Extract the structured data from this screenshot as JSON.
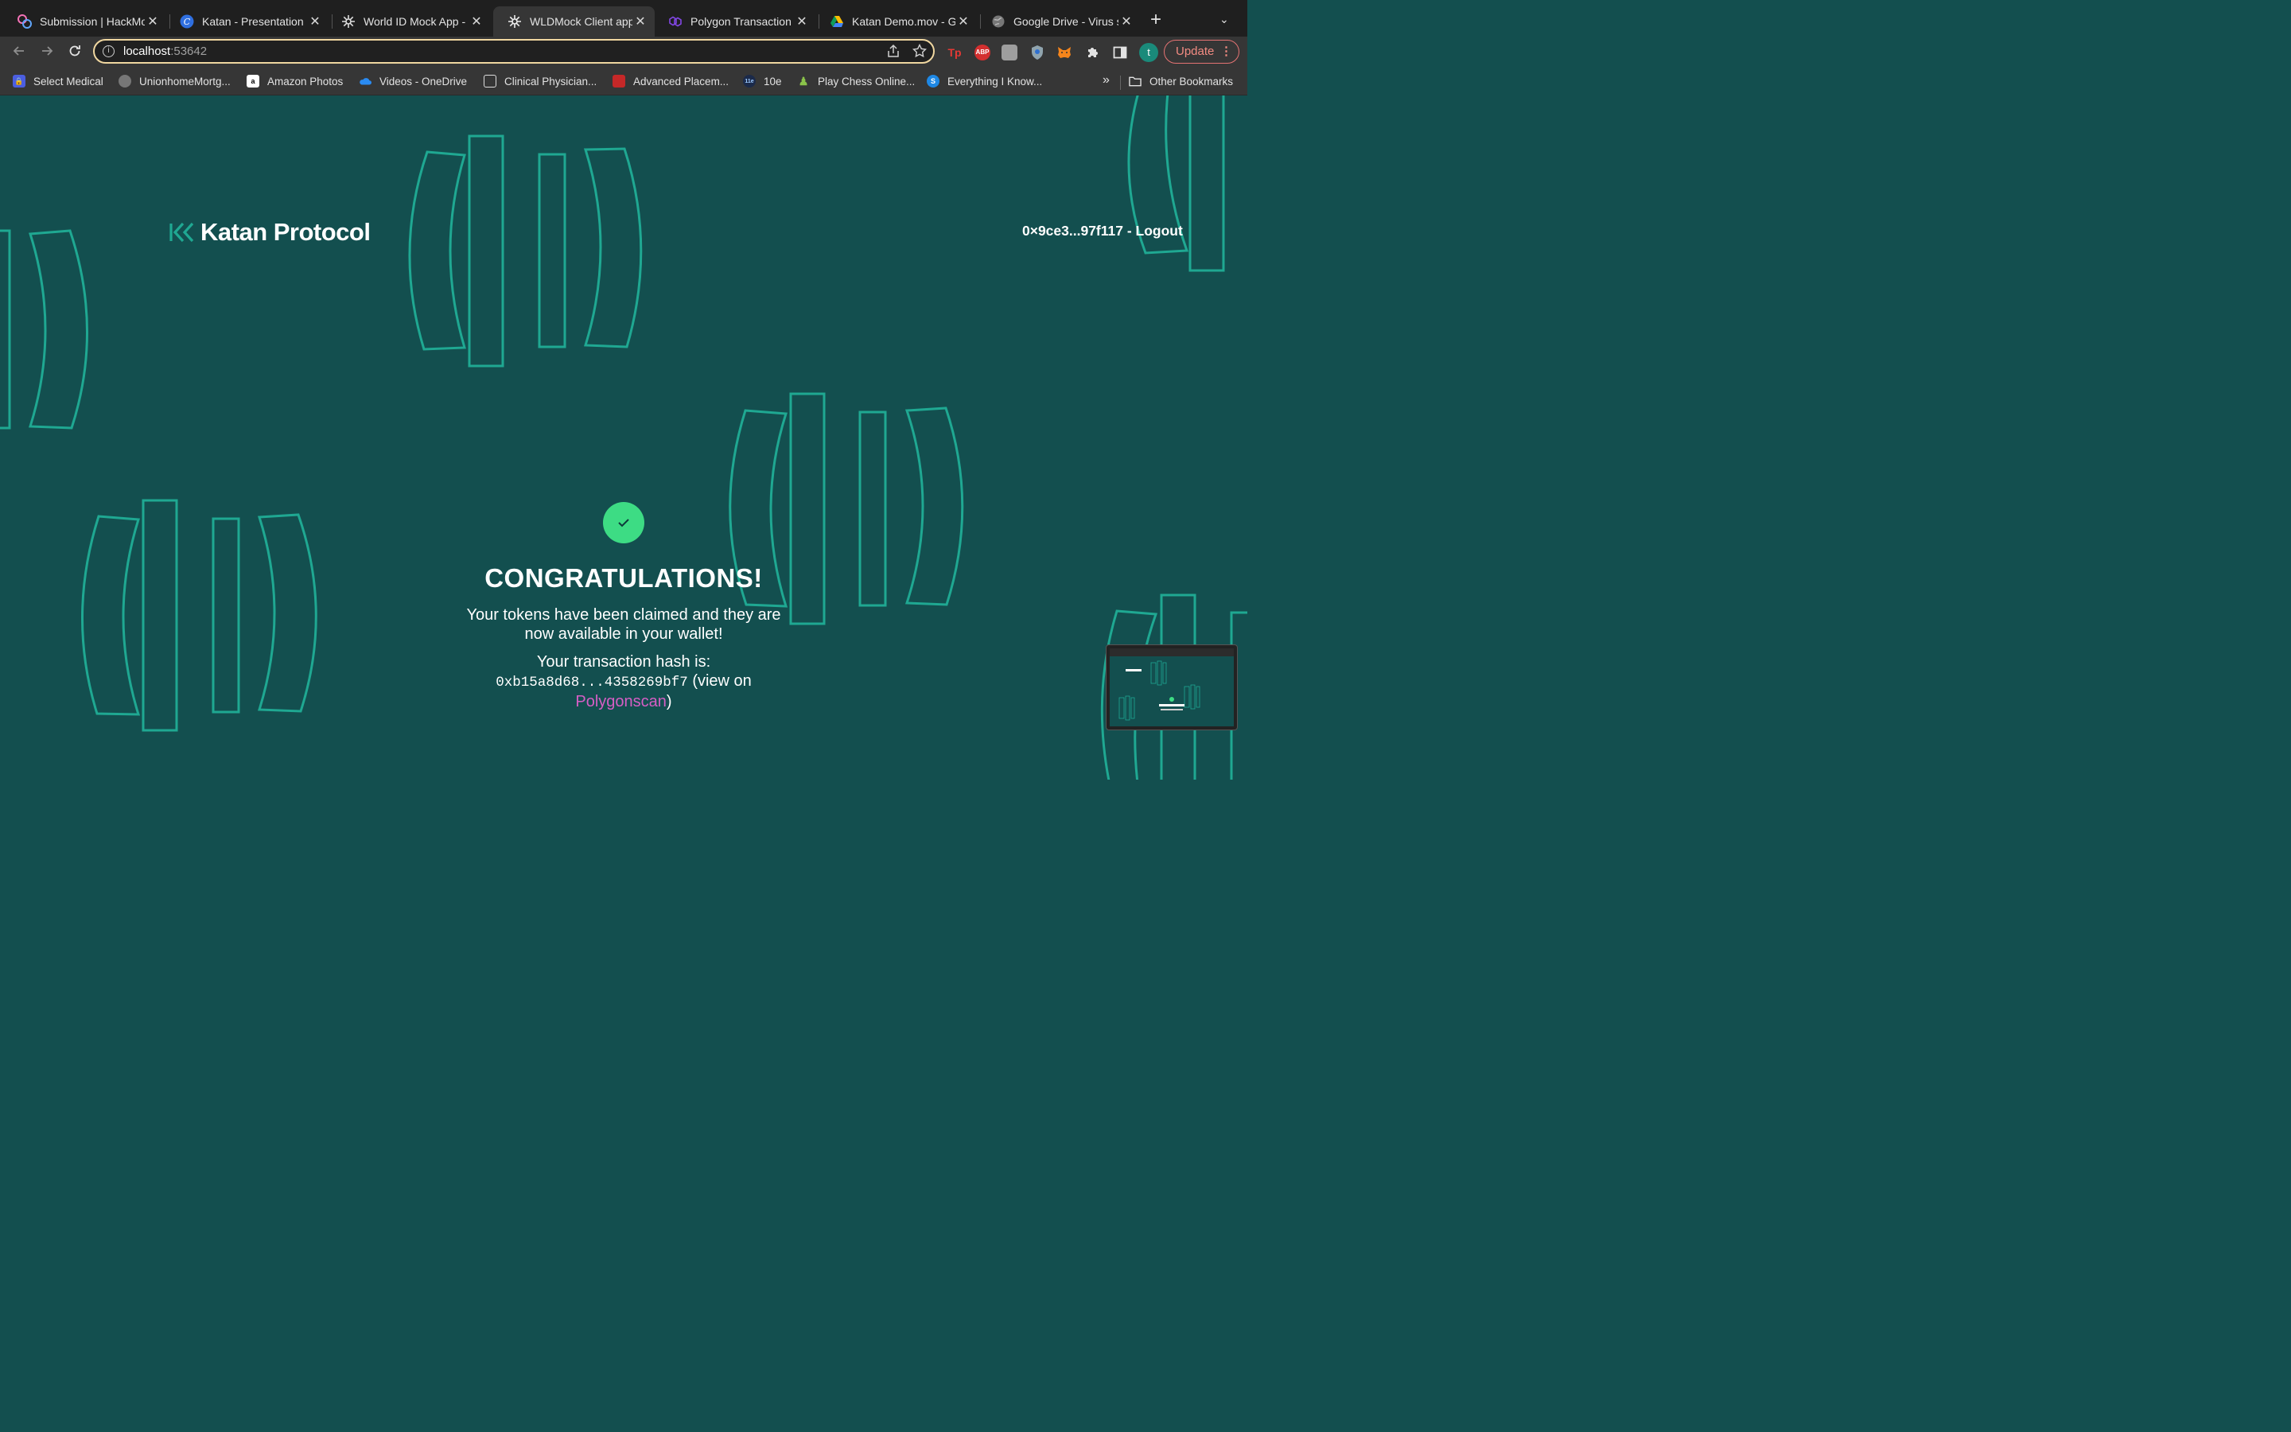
{
  "browser": {
    "tabs": [
      {
        "title": "Submission | HackMo",
        "icon": "hackmd-icon"
      },
      {
        "title": "Katan - Presentation",
        "icon": "canva-icon"
      },
      {
        "title": "World ID Mock App -",
        "icon": "worldid-icon"
      },
      {
        "title": "WLDMock Client app",
        "icon": "worldid-icon",
        "active": true
      },
      {
        "title": "Polygon Transaction H",
        "icon": "polygon-icon"
      },
      {
        "title": "Katan Demo.mov - Go",
        "icon": "google-drive-icon"
      },
      {
        "title": "Google Drive - Virus s",
        "icon": "globe-icon"
      }
    ],
    "address": {
      "host": "localhost",
      "port": ":53642"
    },
    "update_label": "Update",
    "profile_initial": "t",
    "bookmarks": [
      {
        "label": "Select Medical",
        "icon": "lock-icon"
      },
      {
        "label": "UnionhomeMortg...",
        "icon": "globe-icon"
      },
      {
        "label": "Amazon Photos",
        "icon": "amazon-icon"
      },
      {
        "label": "Videos - OneDrive",
        "icon": "onedrive-icon"
      },
      {
        "label": "Clinical Physician...",
        "icon": "building-icon"
      },
      {
        "label": "Advanced Placem...",
        "icon": "doc-red-icon"
      },
      {
        "label": "10e",
        "icon": "10e-icon"
      },
      {
        "label": "Play Chess Online...",
        "icon": "chess-pawn-icon"
      },
      {
        "label": "Everything I Know...",
        "icon": "s-logo-icon"
      }
    ],
    "other_bookmarks_label": "Other Bookmarks",
    "extensions": [
      {
        "name": "tp-icon",
        "label": "Tp",
        "color": "#e53935"
      },
      {
        "name": "adblock-icon",
        "label": "ABP",
        "color": "#d32f2f"
      },
      {
        "name": "extension-grey-icon",
        "label": "",
        "color": "#9e9e9e"
      },
      {
        "name": "shield-icon",
        "label": "",
        "color": "#90a4ae"
      },
      {
        "name": "metamask-icon",
        "label": "",
        "color": "#f6851b"
      }
    ]
  },
  "page": {
    "brand": "Katan Protocol",
    "account": "0×9ce3...97f117 - Logout",
    "headline": "CONGRATULATIONS!",
    "subtitle": "Your tokens have been claimed and they are now available in your wallet!",
    "hash_intro": "Your transaction hash is:",
    "hash": "0xb15a8d68...4358269bf7",
    "view_open": "(view on ",
    "link_label": "Polygonscan",
    "view_close": ")",
    "colors": {
      "background": "#134f4f",
      "accent": "#1fa892",
      "success": "#3ddc84",
      "link": "#d65ec5"
    }
  }
}
